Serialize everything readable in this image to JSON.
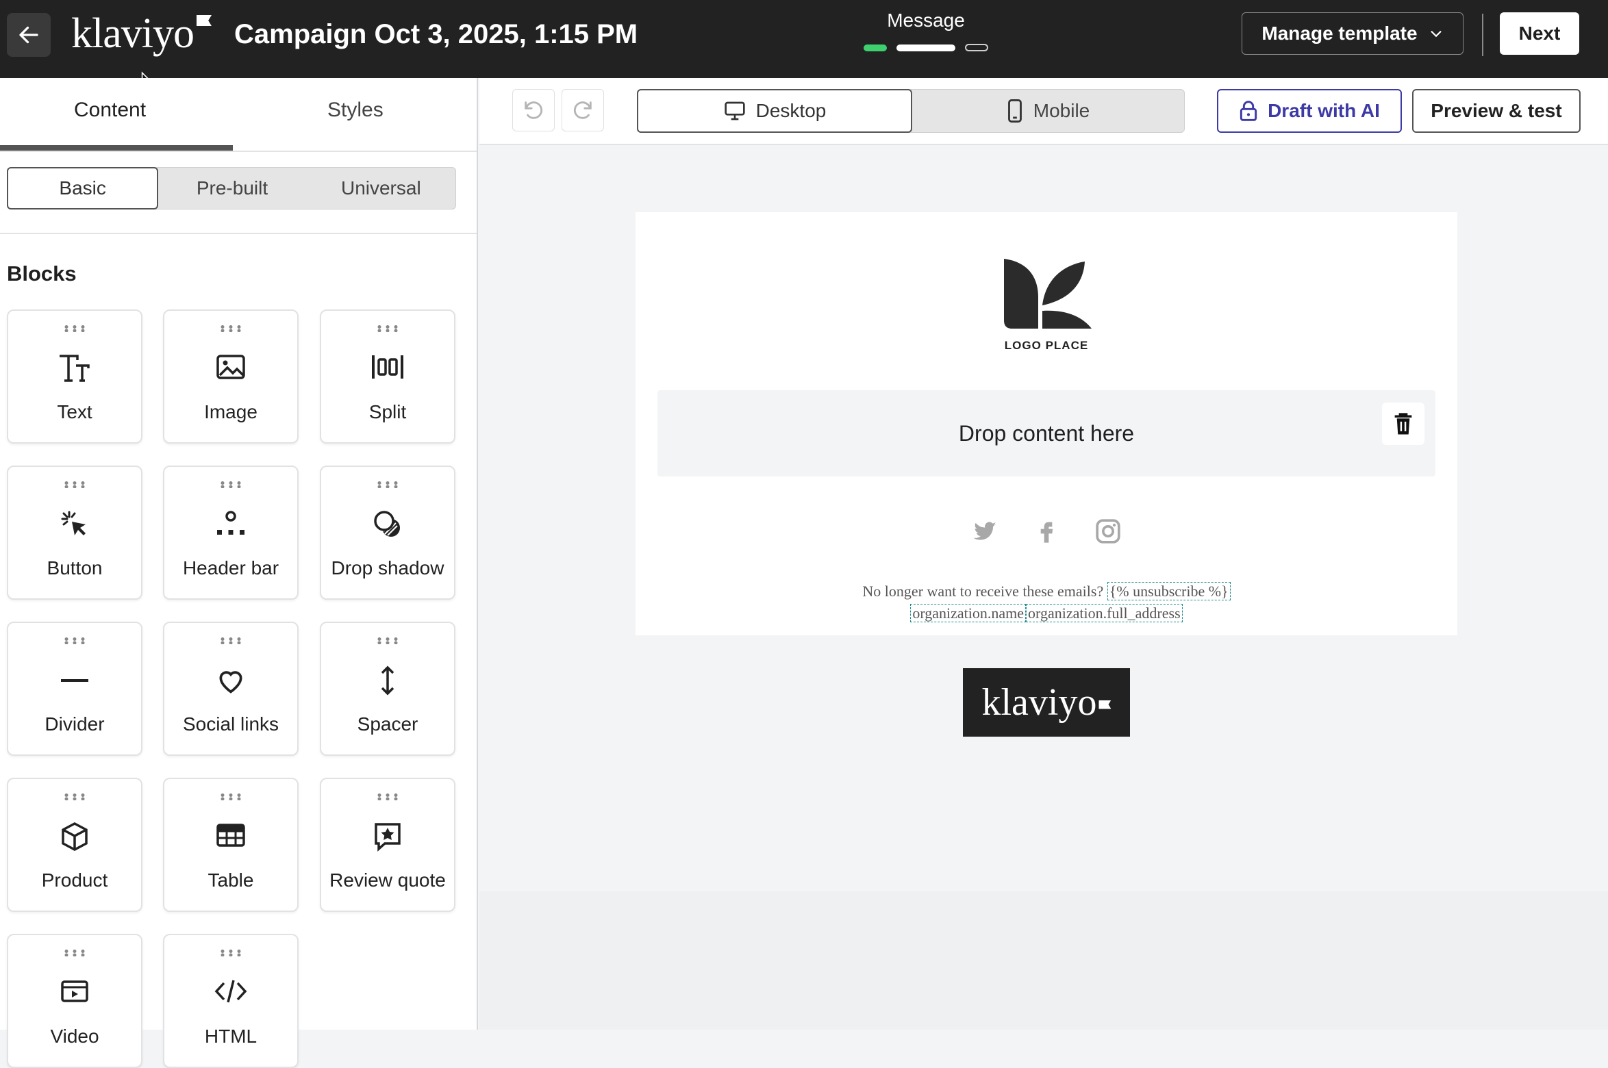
{
  "header": {
    "brand": "klaviyo",
    "campaign_title": "Campaign Oct 3, 2025, 1:15 PM",
    "step_label": "Message",
    "manage_template": "Manage template",
    "next": "Next"
  },
  "left_panel": {
    "tabs": [
      "Content",
      "Styles"
    ],
    "active_tab": "Content",
    "segments": [
      "Basic",
      "Pre-built",
      "Universal"
    ],
    "active_segment": "Basic",
    "blocks_title": "Blocks",
    "blocks": [
      {
        "label": "Text",
        "icon": "text-icon"
      },
      {
        "label": "Image",
        "icon": "image-icon"
      },
      {
        "label": "Split",
        "icon": "split-icon"
      },
      {
        "label": "Button",
        "icon": "cursor-click-icon"
      },
      {
        "label": "Header bar",
        "icon": "header-bar-icon"
      },
      {
        "label": "Drop shadow",
        "icon": "drop-shadow-icon"
      },
      {
        "label": "Divider",
        "icon": "divider-icon"
      },
      {
        "label": "Social links",
        "icon": "heart-icon"
      },
      {
        "label": "Spacer",
        "icon": "spacer-icon"
      },
      {
        "label": "Product",
        "icon": "box-icon"
      },
      {
        "label": "Table",
        "icon": "table-icon"
      },
      {
        "label": "Review quote",
        "icon": "star-quote-icon"
      },
      {
        "label": "Video",
        "icon": "video-icon"
      },
      {
        "label": "HTML",
        "icon": "code-icon"
      }
    ]
  },
  "toolbar": {
    "desktop": "Desktop",
    "mobile": "Mobile",
    "active_device": "Desktop",
    "draft_ai": "Draft with AI",
    "preview": "Preview & test"
  },
  "email": {
    "logo_text": "LOGO PLACE",
    "drop_text": "Drop content here",
    "footer_line1": "No longer want to receive these emails?",
    "unsubscribe_tag": "{% unsubscribe %}",
    "org_name_tag": "organization.name",
    "org_address_tag": "organization.full_address",
    "badge": "klaviyo"
  },
  "colors": {
    "topbar": "#222222",
    "progress_done": "#3ecf6e",
    "ai_accent": "#3d3aa6"
  }
}
